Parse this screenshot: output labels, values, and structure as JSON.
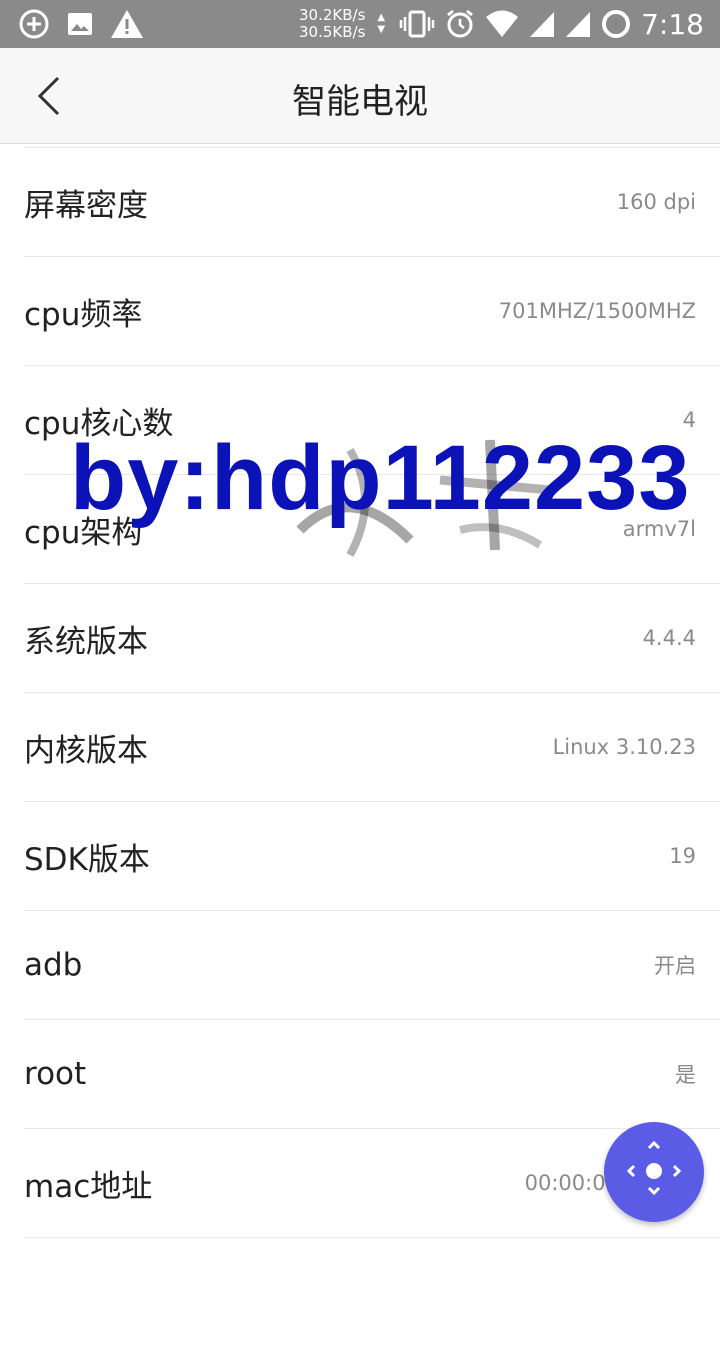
{
  "status_bar": {
    "speed_down": "30.2KB/s",
    "speed_up": "30.5KB/s",
    "time": "7:18",
    "icons": [
      "add-circle-icon",
      "image-icon",
      "warning-icon",
      "vibrate-icon",
      "alarm-icon",
      "wifi-icon",
      "signal-icon",
      "signal-icon",
      "battery-ring-icon"
    ]
  },
  "header": {
    "title": "智能电视",
    "back_icon": "chevron-left-icon"
  },
  "info": [
    {
      "label": "屏幕密度",
      "value": "160 dpi"
    },
    {
      "label": "cpu频率",
      "value": "701MHZ/1500MHZ"
    },
    {
      "label": "cpu核心数",
      "value": "4"
    },
    {
      "label": "cpu架构",
      "value": "armv7l"
    },
    {
      "label": "系统版本",
      "value": "4.4.4"
    },
    {
      "label": "内核版本",
      "value": "Linux 3.10.23"
    },
    {
      "label": "SDK版本",
      "value": "19"
    },
    {
      "label": "adb",
      "value": "开启"
    },
    {
      "label": "root",
      "value": "是"
    },
    {
      "label": "mac地址",
      "value": "00:00:00:"
    }
  ],
  "watermark": {
    "text": "by:hdp112233"
  },
  "fab": {
    "icon": "dpad-remote-icon",
    "color": "#5b5ce6"
  },
  "colors": {
    "accent": "#0a12b8",
    "statusbar": "#8a8a8a"
  }
}
